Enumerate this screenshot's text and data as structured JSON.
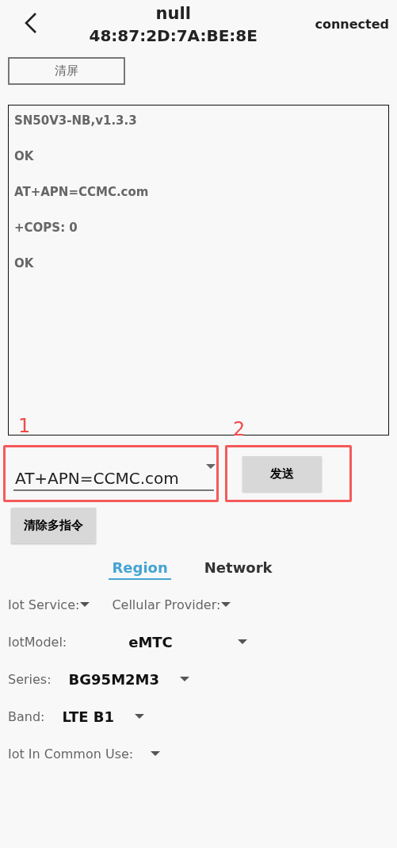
{
  "header": {
    "title": "null",
    "subtitle": "48:87:2D:7A:BE:8E",
    "status": "connected"
  },
  "clear_button": "清屏",
  "console": {
    "blocks": [
      {
        "lines": [
          "SN50V3-NB,v1.3.3",
          "OK"
        ]
      },
      {
        "lines": [
          "AT+APN=CCMC.com"
        ]
      },
      {
        "lines": [
          "+COPS: 0",
          "OK"
        ]
      }
    ]
  },
  "command": {
    "value": "AT+APN=CCMC.com",
    "send_button": "发送"
  },
  "annotations": [
    {
      "label": "1"
    },
    {
      "label": "2"
    }
  ],
  "clear_multi_button": "清除多指令",
  "tabs": [
    {
      "label": "Region",
      "selected": true
    },
    {
      "label": "Network",
      "selected": false
    }
  ],
  "form": [
    {
      "kind": "pair",
      "items": [
        {
          "label": "Iot Service:"
        },
        {
          "label": "Cellular Provider:"
        }
      ]
    },
    {
      "kind": "select",
      "label": "IotModel:",
      "value": "eMTC"
    },
    {
      "kind": "select",
      "label": "Series:",
      "value": "BG95M2M3"
    },
    {
      "kind": "select",
      "label": "Band:",
      "value": "LTE B1"
    },
    {
      "kind": "select",
      "label": "Iot In Common Use:"
    }
  ]
}
